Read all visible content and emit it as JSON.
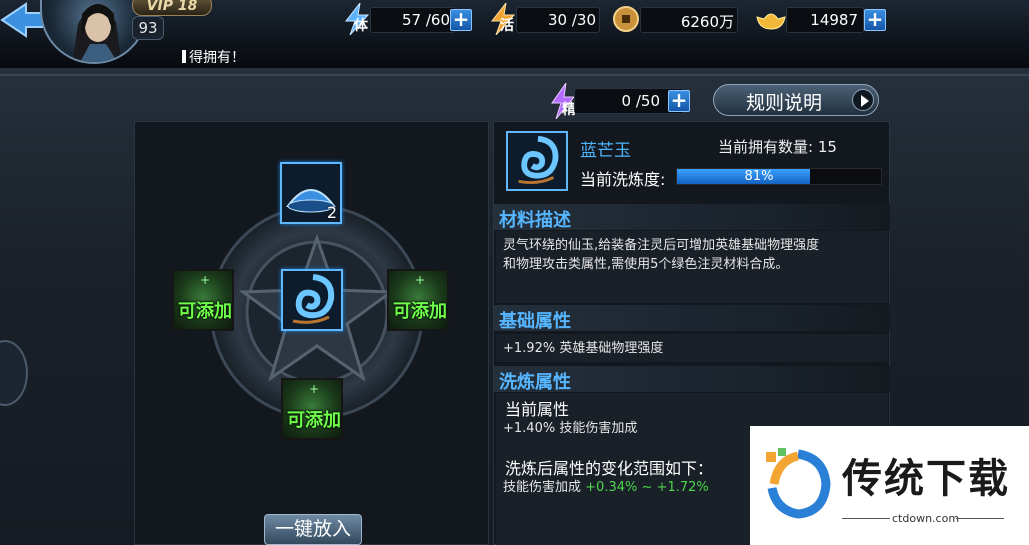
{
  "topbar": {
    "vip": "VIP 18",
    "level": "93",
    "ticker": "得拥有！",
    "stamina": {
      "label": "体",
      "value": "57 /60"
    },
    "vitality": {
      "label": "活",
      "value": "30 /30"
    },
    "coins": {
      "value": "6260万"
    },
    "ingots": {
      "value": "14987"
    }
  },
  "jing": {
    "label": "精",
    "value": "0 /50"
  },
  "rules_button": "规则说明",
  "slots": {
    "top_count": "2",
    "add_label": "可添加"
  },
  "oneclick_button": "一键放入",
  "item": {
    "name": "蓝芒玉",
    "owned_label": "当前拥有数量: 15",
    "refine_label": "当前洗炼度:",
    "refine_percent": "81%",
    "refine_value": 0.81
  },
  "sections": {
    "material_title": "材料描述",
    "material_desc_1": "灵气环绕的仙玉,给装备注灵后可增加英雄基础物理强度",
    "material_desc_2": "和物理攻击类属性,需使用5个绿色注灵材料合成。",
    "base_title": "基础属性",
    "base_attr": "+1.92% 英雄基础物理强度",
    "refine_title": "洗炼属性",
    "current_attr_title": "当前属性",
    "current_attr": "+1.40% 技能伤害加成",
    "range_title": "洗炼后属性的变化范围如下：",
    "range_name": "技能伤害加成",
    "range_min": "+0.34%",
    "range_sep": "~",
    "range_max": "+1.72%"
  },
  "watermark": {
    "title": "传统下载",
    "sub": "ctdown.com"
  },
  "colors": {
    "accent_blue": "#4fb4ff",
    "add_green": "#6dff4a",
    "range_green": "#4cd64c"
  }
}
